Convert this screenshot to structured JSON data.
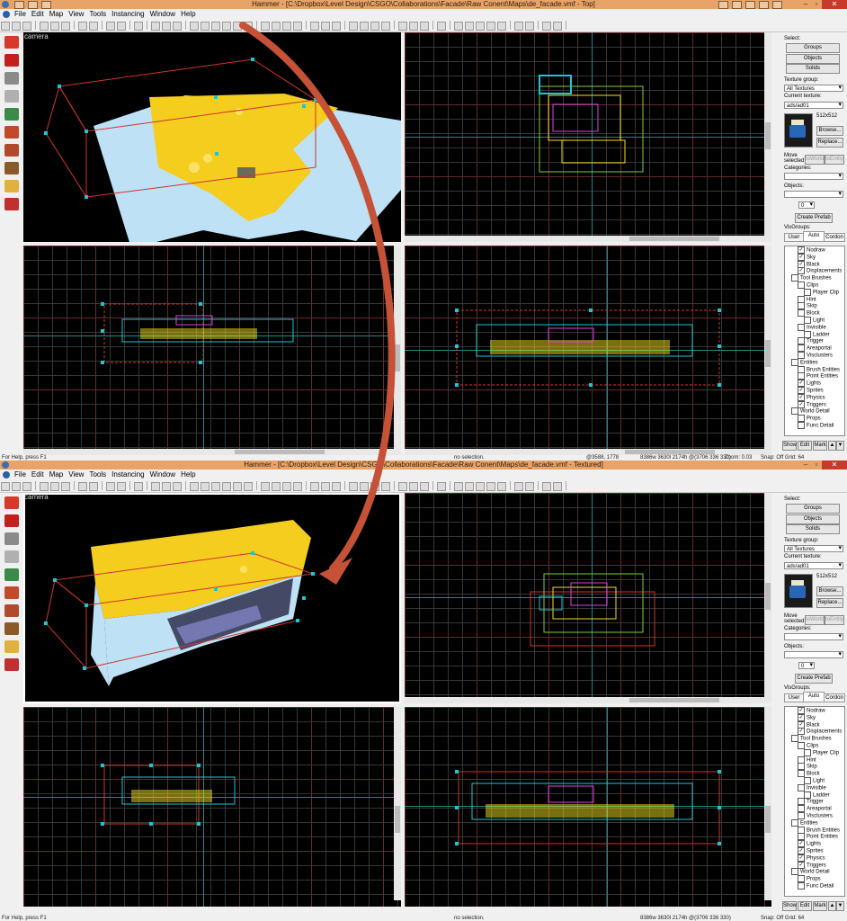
{
  "windows": [
    {
      "title": "Hammer - [C:\\Dropbox\\Level Design\\CSGO\\Collaborations\\Facade\\Raw Conent\\Maps\\de_facade.vmf - Top]",
      "menu": [
        "File",
        "Edit",
        "Map",
        "View",
        "Tools",
        "Instancing",
        "Window",
        "Help"
      ],
      "camera_label": "camera",
      "status": {
        "left": "For Help, press F1",
        "mid": "no selection.",
        "coords": "@3588, 1778",
        "size": "8386w 3630l 2174h @(3706 336 330)",
        "zoom": "Zoom: 0.03",
        "snap": "Snap: Off Grid: 64"
      }
    },
    {
      "title": "Hammer - [C:\\Dropbox\\Level Design\\CSGO\\Collaborations\\Facade\\Raw Conent\\Maps\\de_facade.vmf - Textured]",
      "menu": [
        "File",
        "Edit",
        "Map",
        "View",
        "Tools",
        "Instancing",
        "Window",
        "Help"
      ],
      "camera_label": "camera",
      "status": {
        "left": "For Help, press F1",
        "mid": "no selection.",
        "coords": "",
        "size": "8386w 3630l 2174h @(3706 336 330)",
        "zoom": "",
        "snap": "Snap: Off Grid: 64"
      }
    }
  ],
  "sidebar": {
    "select_label": "Select:",
    "groups_btn": "Groups",
    "objects_btn": "Objects",
    "solids_btn": "Solids",
    "texture_group_label": "Texture group:",
    "texture_group_value": "All Textures",
    "current_texture_label": "Current texture:",
    "current_texture_value": "ads/ad01",
    "texture_size": "512x512",
    "browse_btn": "Browse...",
    "replace_btn": "Replace...",
    "move_selected_label": "Move selected:",
    "to_world_btn": "toWorld",
    "to_entity_btn": "toEntity",
    "categories_label": "Categories:",
    "objects_label": "Objects:",
    "spinner_value": "0",
    "create_prefab_btn": "Create Prefab",
    "visgroups_label": "VisGroups:",
    "tabs": [
      "User",
      "Auto",
      "Cordon"
    ],
    "visgroups": [
      {
        "label": "Nodraw",
        "indent": 2,
        "checked": true
      },
      {
        "label": "Sky",
        "indent": 2,
        "checked": true
      },
      {
        "label": "Black",
        "indent": 2,
        "checked": true
      },
      {
        "label": "Displacements",
        "indent": 2,
        "checked": true
      },
      {
        "label": "Tool Brushes",
        "indent": 1,
        "checked": false
      },
      {
        "label": "Clips",
        "indent": 2,
        "checked": false
      },
      {
        "label": "Player Clip",
        "indent": 3,
        "checked": false
      },
      {
        "label": "Hint",
        "indent": 2,
        "checked": false
      },
      {
        "label": "Skip",
        "indent": 2,
        "checked": false
      },
      {
        "label": "Block",
        "indent": 2,
        "checked": false
      },
      {
        "label": "Light",
        "indent": 3,
        "checked": false
      },
      {
        "label": "Invisible",
        "indent": 2,
        "checked": false
      },
      {
        "label": "Ladder",
        "indent": 3,
        "checked": false
      },
      {
        "label": "Trigger",
        "indent": 2,
        "checked": false
      },
      {
        "label": "Areaportal",
        "indent": 2,
        "checked": false
      },
      {
        "label": "Visclusters",
        "indent": 2,
        "checked": false
      },
      {
        "label": "Entities",
        "indent": 1,
        "checked": false
      },
      {
        "label": "Brush Entities",
        "indent": 2,
        "checked": false
      },
      {
        "label": "Point Entities",
        "indent": 2,
        "checked": false
      },
      {
        "label": "Lights",
        "indent": 2,
        "checked": true
      },
      {
        "label": "Sprites",
        "indent": 2,
        "checked": true
      },
      {
        "label": "Physics",
        "indent": 2,
        "checked": true
      },
      {
        "label": "Triggers",
        "indent": 2,
        "checked": true
      },
      {
        "label": "World Detail",
        "indent": 1,
        "checked": false
      },
      {
        "label": "Props",
        "indent": 2,
        "checked": false
      },
      {
        "label": "Func Detail",
        "indent": 2,
        "checked": false
      }
    ],
    "show_btn": "Show",
    "edit_btn": "Edit",
    "mark_btn": "Mark",
    "up_btn": "▲",
    "down_btn": "▼"
  },
  "colors": {
    "titlebar": "#e8a468",
    "viewport_bg": "#000000",
    "sky_blue": "#bfe1f5",
    "brush_yellow": "#f5cd1e",
    "selection_red": "#d0342c",
    "handle_cyan": "#19c7d6",
    "arrow": "#c55136"
  }
}
